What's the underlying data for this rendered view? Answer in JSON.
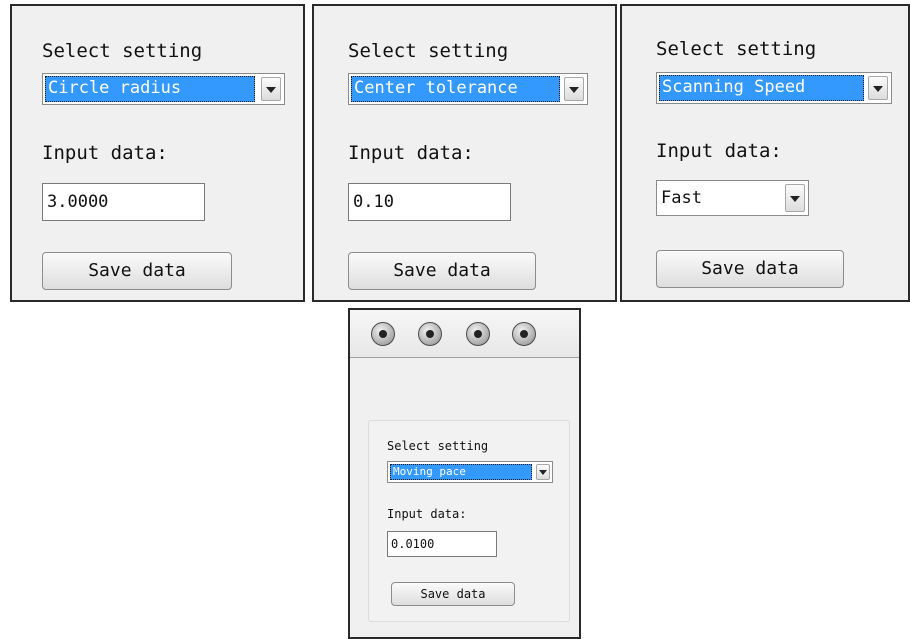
{
  "panels": [
    {
      "title": "Select setting",
      "selected": "Circle radius",
      "input_label": "Input data:",
      "input_value": "3.0000",
      "save_label": "Save data"
    },
    {
      "title": "Select setting",
      "selected": "Center tolerance",
      "input_label": "Input data:",
      "input_value": "0.10",
      "save_label": "Save data"
    },
    {
      "title": "Select setting",
      "selected": "Scanning Speed",
      "input_label": "Input data:",
      "input_value": "Fast",
      "save_label": "Save data"
    }
  ],
  "bottom_panel": {
    "toolbar_icons": [
      "arrow-up-icon",
      "arrow-down-icon",
      "arrow-left-icon",
      "arrow-right-icon"
    ],
    "title": "Select setting",
    "selected": "Moving pace",
    "input_label": "Input data:",
    "input_value": "0.0100",
    "save_label": "Save data"
  },
  "colors": {
    "selection": "#3399ff",
    "panel_bg": "#f0f0f0",
    "border": "#2a2a2a"
  }
}
